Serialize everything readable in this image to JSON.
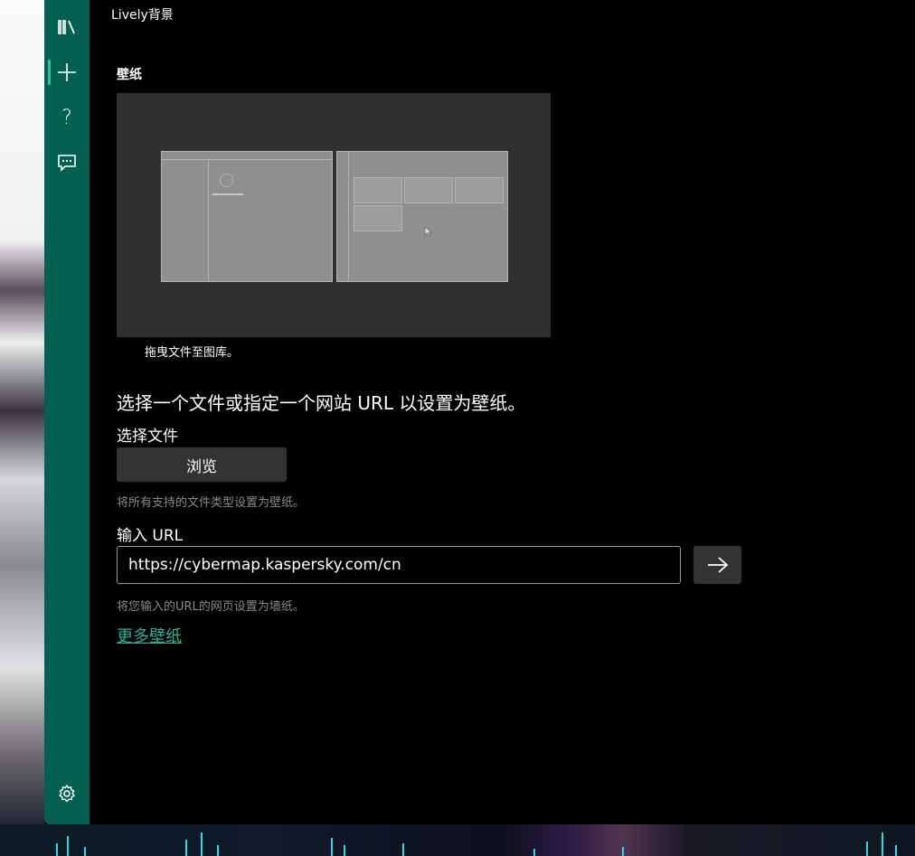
{
  "window": {
    "title": "Lively背景"
  },
  "nav": {
    "items": [
      {
        "name": "library",
        "icon": "library-icon"
      },
      {
        "name": "add",
        "icon": "plus-icon"
      },
      {
        "name": "help",
        "icon": "help-icon"
      },
      {
        "name": "feedback",
        "icon": "feedback-icon"
      }
    ],
    "settings_icon": "gear-icon",
    "accent": "#046151"
  },
  "main": {
    "section_title": "壁纸",
    "preview_caption": "拖曳文件至图库。",
    "headline": "选择一个文件或指定一个网站 URL 以设置为壁纸。",
    "file": {
      "label": "选择文件",
      "browse_label": "浏览",
      "hint": "将所有支持的文件类型设置为壁纸。"
    },
    "url": {
      "label": "输入 URL",
      "value": "https://cybermap.kaspersky.com/cn",
      "hint": "将您输入的URL的网页设置为墙纸。",
      "go_icon": "arrow-right-icon"
    },
    "more_link": "更多壁纸",
    "link_color": "#27b595"
  }
}
